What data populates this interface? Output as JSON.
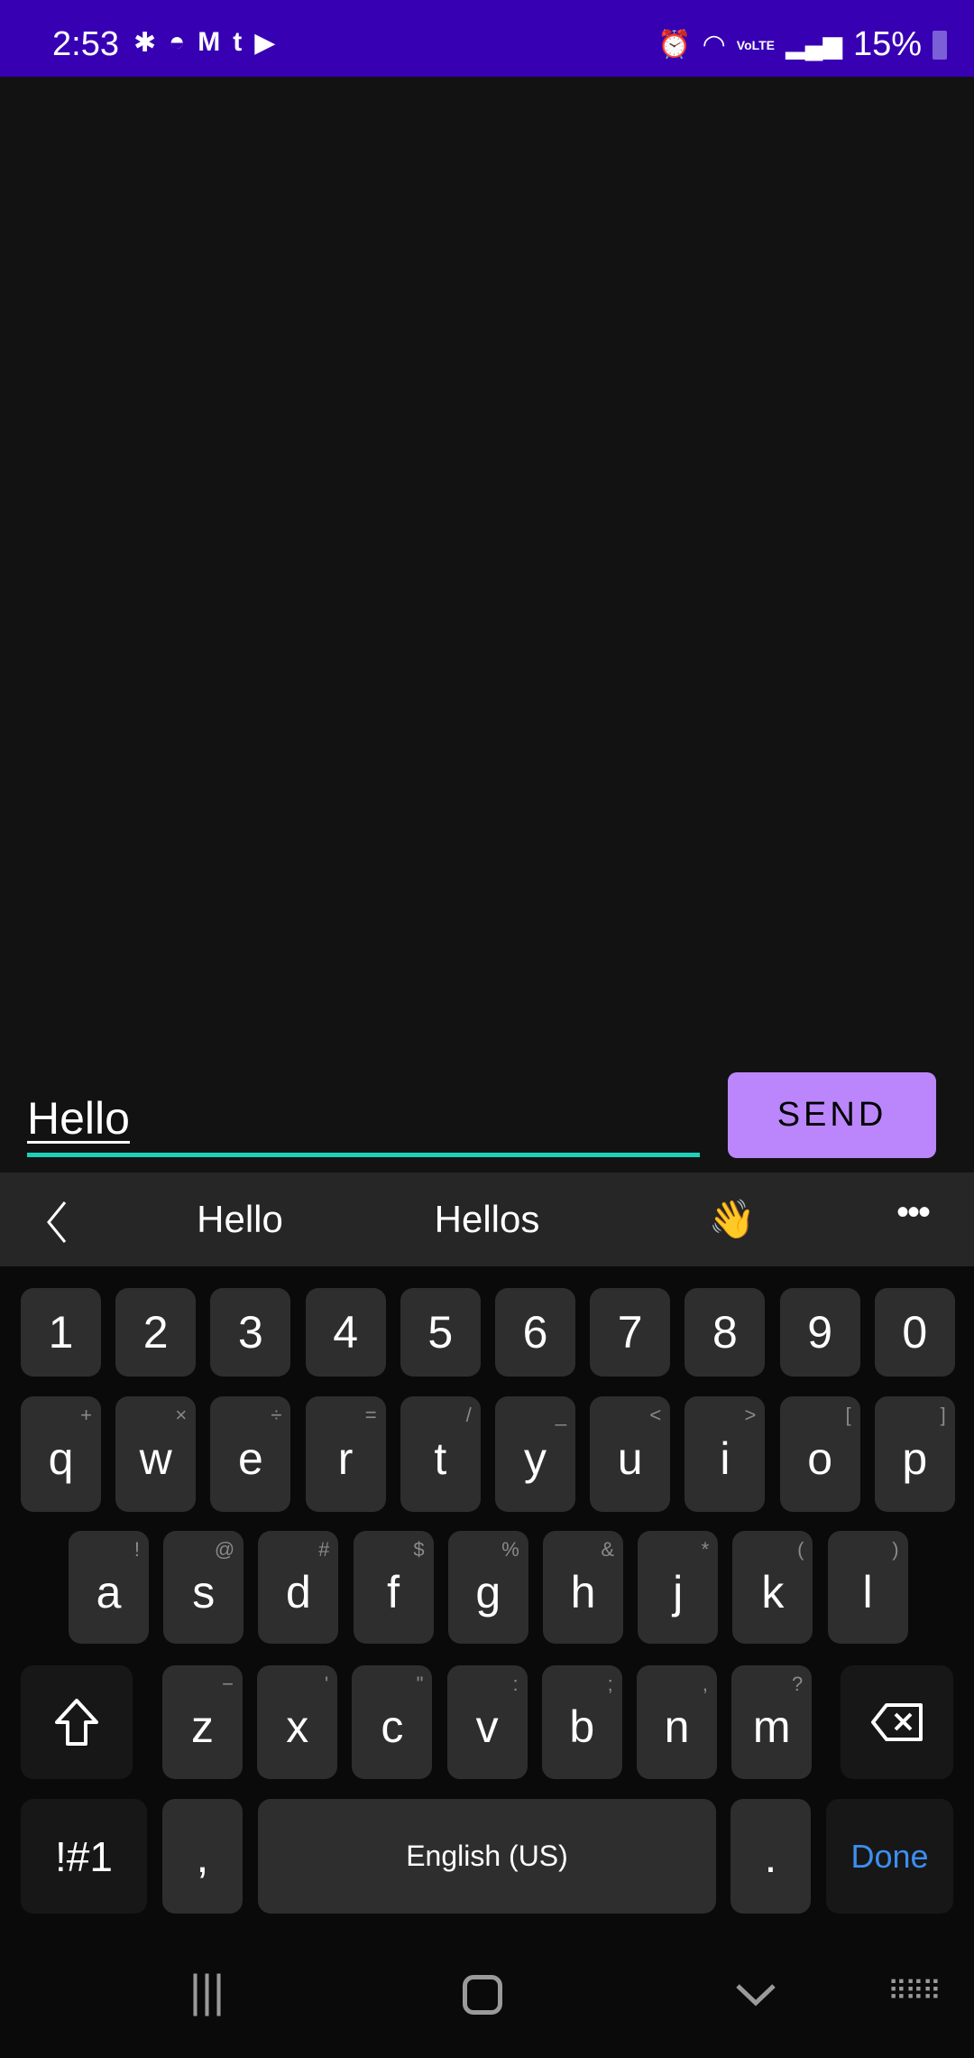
{
  "status_bar": {
    "time": "2:53",
    "notification_icons": [
      "slack-icon",
      "discord-icon",
      "gmail-icon",
      "tumblr-icon",
      "youtube-icon"
    ],
    "system_icons": [
      "alarm-icon",
      "wifi-icon",
      "volte-icon",
      "signal-icon"
    ],
    "volte": "VoLTE",
    "battery": "15%",
    "bg_color": "#3700b3"
  },
  "composer": {
    "message_value": "Hello",
    "send_label": "SEND",
    "accent": "#bb86fc",
    "underline_color": "#1dd1b8"
  },
  "suggestions": {
    "items": [
      "Hello",
      "Hellos",
      "👋"
    ],
    "back_icon": "chevron-left-icon",
    "more_icon": "more-horizontal-icon"
  },
  "keyboard": {
    "numbers": [
      "1",
      "2",
      "3",
      "4",
      "5",
      "6",
      "7",
      "8",
      "9",
      "0"
    ],
    "row1": [
      [
        "q",
        "+"
      ],
      [
        "w",
        "×"
      ],
      [
        "e",
        "÷"
      ],
      [
        "r",
        "="
      ],
      [
        "t",
        "/"
      ],
      [
        "y",
        "_"
      ],
      [
        "u",
        "<"
      ],
      [
        "i",
        ">"
      ],
      [
        "o",
        "["
      ],
      [
        "p",
        "]"
      ]
    ],
    "row2": [
      [
        "a",
        "!"
      ],
      [
        "s",
        "@"
      ],
      [
        "d",
        "#"
      ],
      [
        "f",
        "$"
      ],
      [
        "g",
        "%"
      ],
      [
        "h",
        "&"
      ],
      [
        "j",
        "*"
      ],
      [
        "k",
        "("
      ],
      [
        "l",
        ")"
      ]
    ],
    "row3": [
      [
        "z",
        "−"
      ],
      [
        "x",
        "'"
      ],
      [
        "c",
        "\""
      ],
      [
        "v",
        ":"
      ],
      [
        "b",
        ";"
      ],
      [
        "n",
        ","
      ],
      [
        "m",
        "?"
      ]
    ],
    "symbols_label": "!#1",
    "comma": ",",
    "space_label": "English (US)",
    "period": ".",
    "done_label": "Done",
    "done_color": "#3d8ef0"
  },
  "nav_bar": {
    "icons": [
      "recent-apps-icon",
      "home-icon",
      "back-icon",
      "keyboard-icon"
    ]
  }
}
